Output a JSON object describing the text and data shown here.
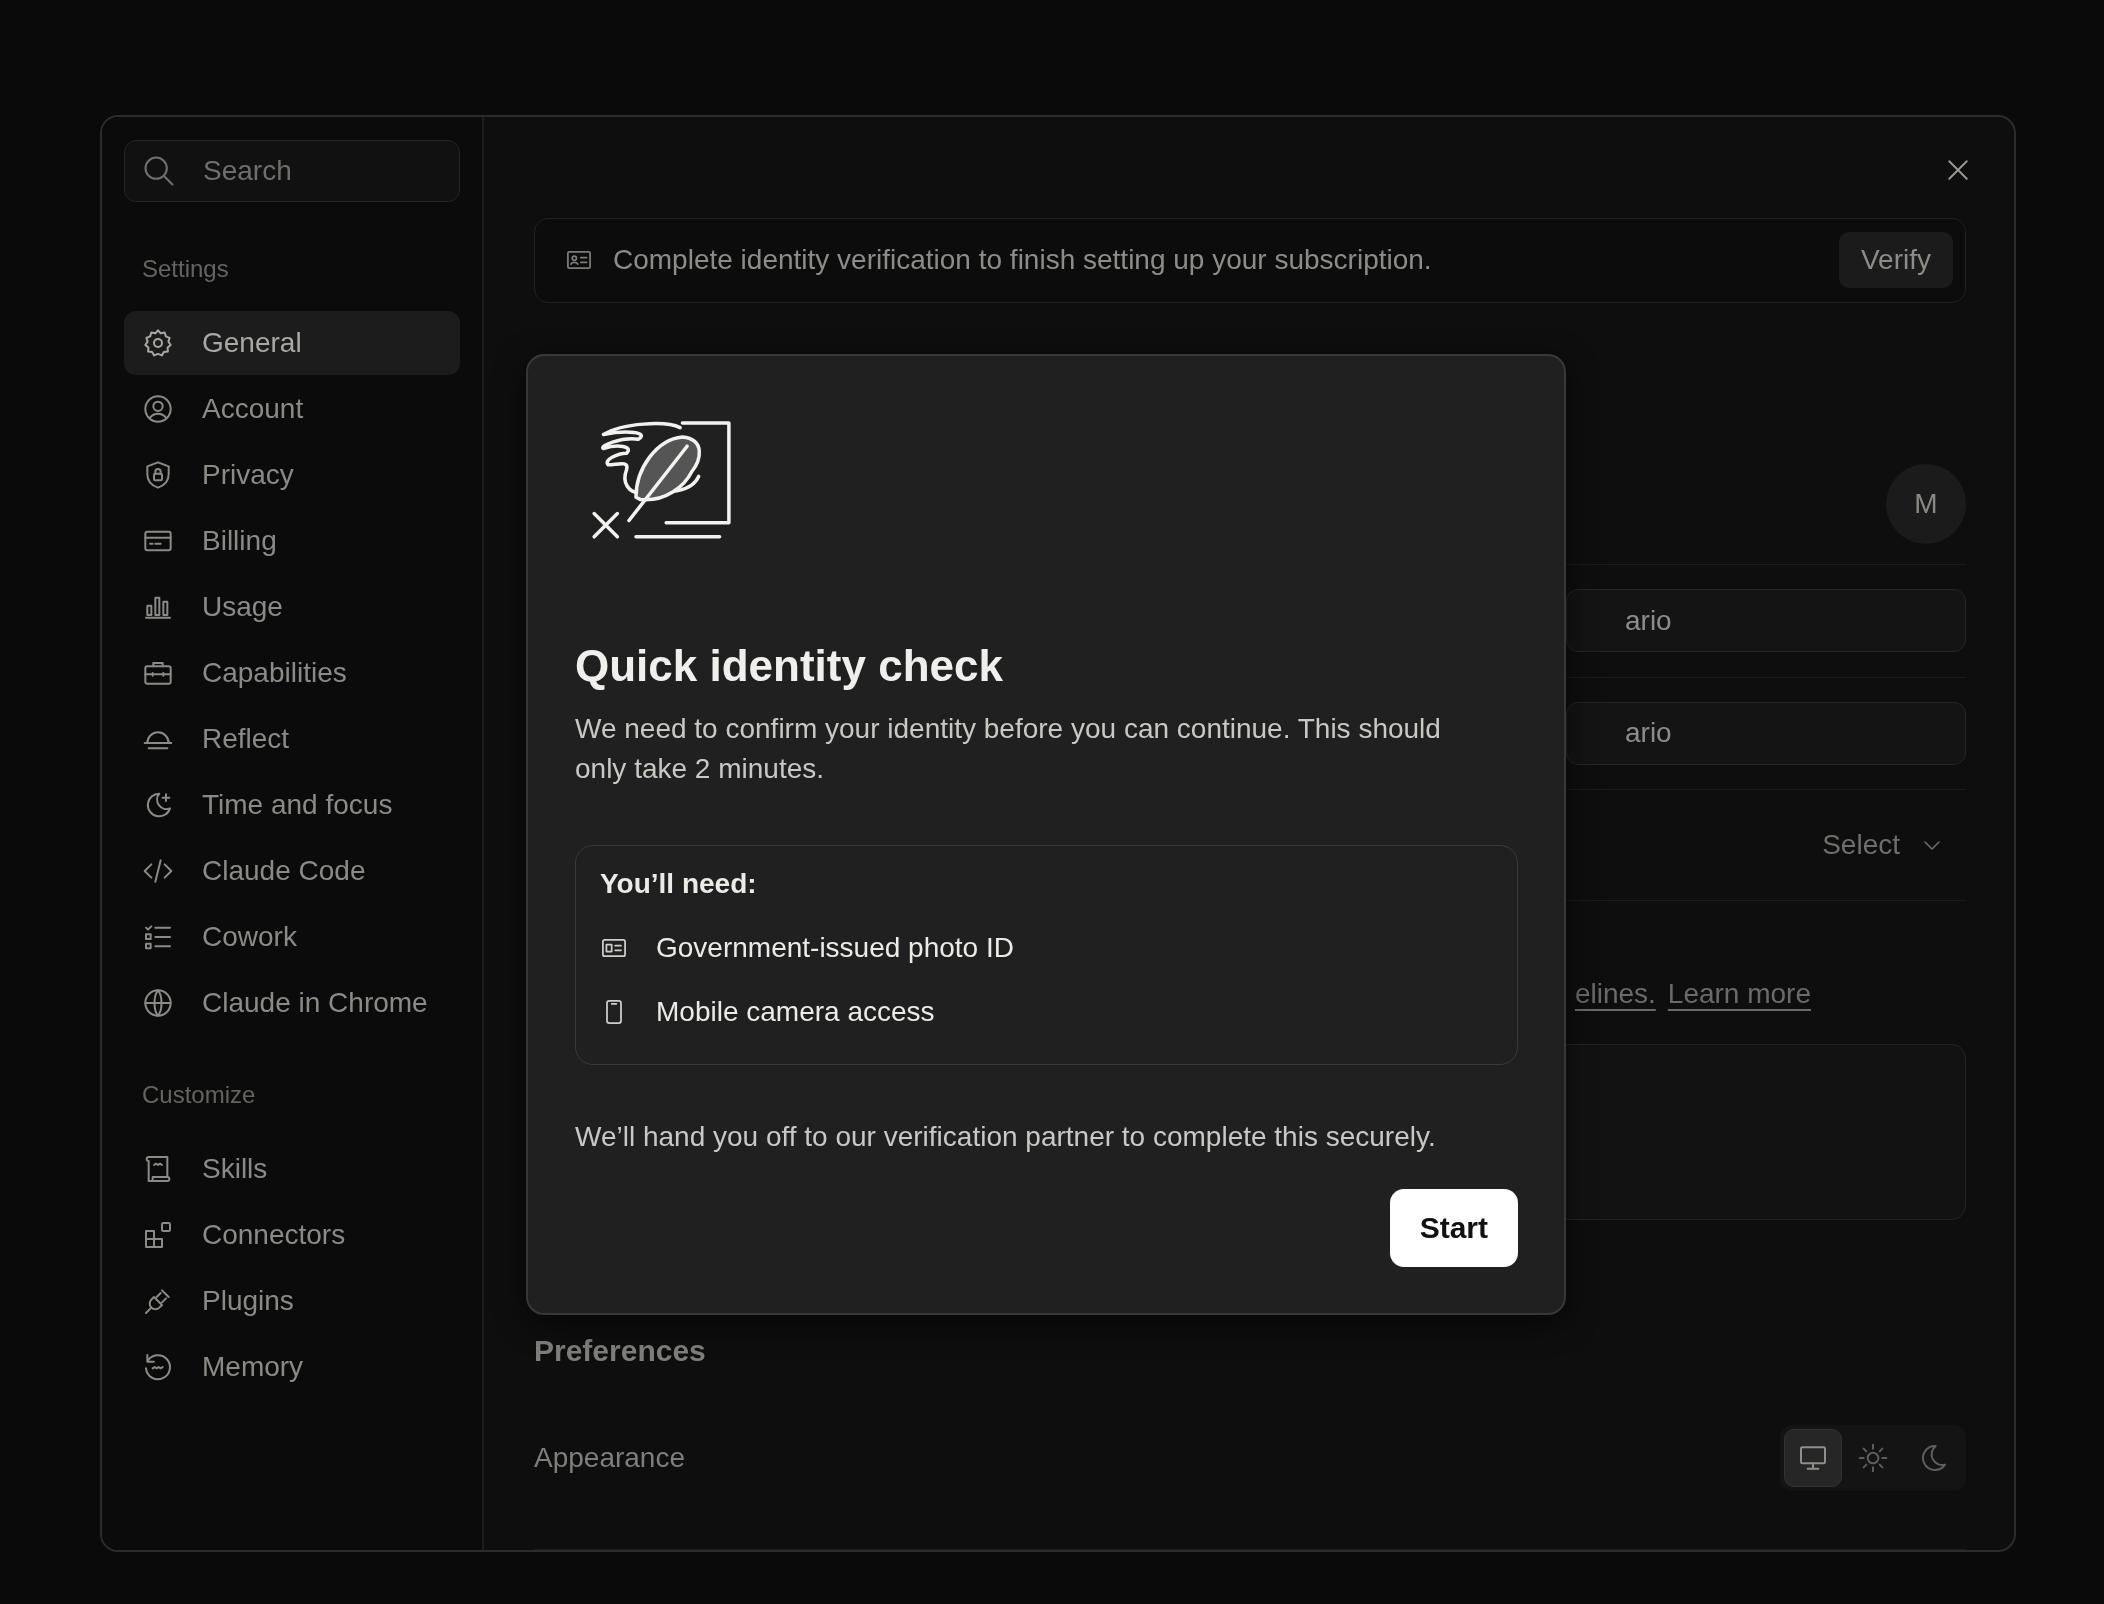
{
  "sidebar": {
    "search": {
      "placeholder": "Search"
    },
    "sections": [
      {
        "heading": "Settings",
        "items": [
          {
            "label": "General",
            "kind": "gear",
            "selected": true
          },
          {
            "label": "Account",
            "kind": "user",
            "selected": false
          },
          {
            "label": "Privacy",
            "kind": "shield",
            "selected": false
          },
          {
            "label": "Billing",
            "kind": "card",
            "selected": false
          },
          {
            "label": "Usage",
            "kind": "bars",
            "selected": false
          },
          {
            "label": "Capabilities",
            "kind": "case",
            "selected": false
          },
          {
            "label": "Reflect",
            "kind": "dome",
            "selected": false
          },
          {
            "label": "Time and focus",
            "kind": "moon",
            "selected": false
          },
          {
            "label": "Claude Code",
            "kind": "code",
            "selected": false
          },
          {
            "label": "Cowork",
            "kind": "list",
            "selected": false
          },
          {
            "label": "Claude in Chrome",
            "kind": "globe",
            "selected": false
          }
        ]
      },
      {
        "heading": "Customize",
        "items": [
          {
            "label": "Skills",
            "kind": "scroll",
            "selected": false
          },
          {
            "label": "Connectors",
            "kind": "blocks",
            "selected": false
          },
          {
            "label": "Plugins",
            "kind": "plug",
            "selected": false
          },
          {
            "label": "Memory",
            "kind": "memory",
            "selected": false
          }
        ]
      }
    ]
  },
  "banner": {
    "text": "Complete identity verification to finish setting up your subscription.",
    "button": "Verify"
  },
  "profile": {
    "avatar": "M",
    "fields": [
      "ario",
      "ario"
    ],
    "select": "Select",
    "link_texts": [
      "elines.",
      "Learn more"
    ]
  },
  "preferences": {
    "heading": "Preferences",
    "appearance": {
      "label": "Appearance",
      "options": [
        {
          "kind": "monitor",
          "selected": true
        },
        {
          "kind": "sun",
          "selected": false
        },
        {
          "kind": "crescent",
          "selected": false
        }
      ]
    }
  },
  "dialog": {
    "title": "Quick identity check",
    "body": "We need to confirm your identity before you can continue. This should only take 2 minutes.",
    "needs": {
      "heading": "You’ll need:",
      "items": [
        {
          "kind": "idcard",
          "label": "Government-issued photo ID"
        },
        {
          "kind": "phone",
          "label": "Mobile camera access"
        }
      ]
    },
    "note": "We’ll hand you off to our verification partner to complete this securely.",
    "button": "Start"
  }
}
